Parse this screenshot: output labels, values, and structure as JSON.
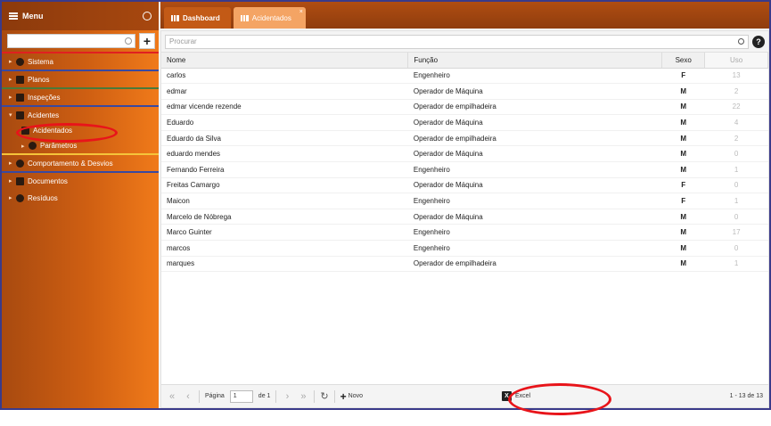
{
  "sidebar": {
    "title": "Menu",
    "items": [
      {
        "label": "Sistema"
      },
      {
        "label": "Planos"
      },
      {
        "label": "Inspeções"
      },
      {
        "label": "Acidentes"
      },
      {
        "label": "Acidentados"
      },
      {
        "label": "Parâmetros"
      },
      {
        "label": "Comportamento & Desvios"
      },
      {
        "label": "Documentos"
      },
      {
        "label": "Resíduos"
      }
    ]
  },
  "tabs": [
    {
      "label": "Dashboard"
    },
    {
      "label": "Acidentados"
    }
  ],
  "search": {
    "placeholder": "Procurar"
  },
  "table": {
    "headers": {
      "nome": "Nome",
      "funcao": "Função",
      "sexo": "Sexo",
      "uso": "Uso"
    },
    "rows": [
      {
        "nome": "carlos",
        "funcao": "Engenheiro",
        "sexo": "F",
        "uso": "13"
      },
      {
        "nome": "edmar",
        "funcao": "Operador de Máquina",
        "sexo": "M",
        "uso": "2"
      },
      {
        "nome": "edmar vicende rezende",
        "funcao": "Operador de empilhadeira",
        "sexo": "M",
        "uso": "22"
      },
      {
        "nome": "Eduardo",
        "funcao": "Operador de Máquina",
        "sexo": "M",
        "uso": "4"
      },
      {
        "nome": "Eduardo da Silva",
        "funcao": "Operador de empilhadeira",
        "sexo": "M",
        "uso": "2"
      },
      {
        "nome": "eduardo mendes",
        "funcao": "Operador de Máquina",
        "sexo": "M",
        "uso": "0"
      },
      {
        "nome": "Fernando Ferreira",
        "funcao": "Engenheiro",
        "sexo": "M",
        "uso": "1"
      },
      {
        "nome": "Freitas Camargo",
        "funcao": "Operador de Máquina",
        "sexo": "F",
        "uso": "0"
      },
      {
        "nome": "Maicon",
        "funcao": "Engenheiro",
        "sexo": "F",
        "uso": "1"
      },
      {
        "nome": "Marcelo de Nóbrega",
        "funcao": "Operador de Máquina",
        "sexo": "M",
        "uso": "0"
      },
      {
        "nome": "Marco Guinter",
        "funcao": "Engenheiro",
        "sexo": "M",
        "uso": "17"
      },
      {
        "nome": "marcos",
        "funcao": "Engenheiro",
        "sexo": "M",
        "uso": "0"
      },
      {
        "nome": "marques",
        "funcao": "Operador de empilhadeira",
        "sexo": "M",
        "uso": "1"
      }
    ]
  },
  "pager": {
    "page_label": "Página",
    "page_value": "1",
    "of_label": "de 1",
    "new_label": "Novo",
    "excel_label": "Excel",
    "count": "1 - 13 de 13"
  }
}
